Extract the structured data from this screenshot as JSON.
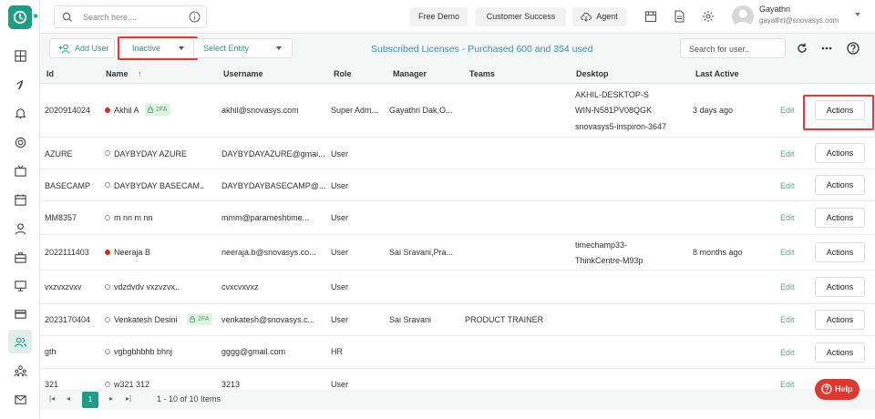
{
  "topbar": {
    "search_placeholder": "Search here....",
    "free_demo": "Free Demo",
    "customer_success": "Customer Success",
    "agent": "Agent",
    "user_name": "Gayathri",
    "user_email": "gayathri@snovasys.com"
  },
  "toolbar": {
    "add_user": "Add User",
    "status_filter": "Inactive",
    "entity_filter": "Select Entity",
    "licenses_text": "Subscribed Licenses - Purchased 600 and 354 used",
    "user_search_placeholder": "Search for user.."
  },
  "table": {
    "columns": [
      "Id",
      "Name",
      "Username",
      "Role",
      "Manager",
      "Teams",
      "Desktop",
      "Last Active"
    ],
    "sort_indicator": "↑",
    "edit_label": "Edit",
    "actions_label": "Actions",
    "badge_2fa": "2FA",
    "rows": [
      {
        "id": "2020914024",
        "name": "Akhil A",
        "username": "akhil@snovasys.com",
        "role": "Super Adm...",
        "manager": "Gayathri Dak,O...",
        "teams": "",
        "desktop1": "AKHIL-DESKTOP-S",
        "desktop2": "WIN-N581PV08QGK",
        "desktop3": "snovasys5-inspiron-3647",
        "last_active": "3 days ago",
        "status": "red",
        "twofa": true
      },
      {
        "id": "AZURE",
        "name": "DAYBYDAY AZURE",
        "username": "DAYBYDAYAZURE@gmai...",
        "role": "User",
        "manager": "",
        "teams": "",
        "desktop1": "",
        "desktop2": "",
        "desktop3": "",
        "last_active": "",
        "status": "ring",
        "twofa": false
      },
      {
        "id": "BASECAMP",
        "name": "DAYBYDAY BASECAM..",
        "username": "DAYBYDAYBASECAMP@...",
        "role": "User",
        "manager": "",
        "teams": "",
        "desktop1": "",
        "desktop2": "",
        "desktop3": "",
        "last_active": "",
        "status": "ring",
        "twofa": false
      },
      {
        "id": "MM8357",
        "name": "m nn m nn",
        "username": "mmm@parameshtime...",
        "role": "User",
        "manager": "",
        "teams": "",
        "desktop1": "",
        "desktop2": "",
        "desktop3": "",
        "last_active": "",
        "status": "ring",
        "twofa": false
      },
      {
        "id": "2022111403",
        "name": "Neeraja B",
        "username": "neeraja.b@snovasys.co...",
        "role": "User",
        "manager": "Sai Sravani,Pra...",
        "teams": "",
        "desktop1": "timechamp33-",
        "desktop2": "ThinkCentre-M93p",
        "desktop3": "",
        "last_active": "8 months ago",
        "status": "red",
        "twofa": false
      },
      {
        "id": "vxzvxzvxv",
        "name": "vdzdvdv vxzvzvx..",
        "username": "cvxcvxvxz",
        "role": "User",
        "manager": "",
        "teams": "",
        "desktop1": "",
        "desktop2": "",
        "desktop3": "",
        "last_active": "",
        "status": "ring",
        "twofa": false
      },
      {
        "id": "2023170404",
        "name": "Venkatesh Desini",
        "username": "venkatesh@snovasys.c...",
        "role": "User",
        "manager": "Sai Sravani",
        "teams": "PRODUCT TRAINER",
        "desktop1": "",
        "desktop2": "",
        "desktop3": "",
        "last_active": "",
        "status": "ring",
        "twofa": true
      },
      {
        "id": "gth",
        "name": "vgbgbhbhb bhnj",
        "username": "gggg@gmail.com",
        "role": "HR",
        "manager": "",
        "teams": "",
        "desktop1": "",
        "desktop2": "",
        "desktop3": "",
        "last_active": "",
        "status": "ring",
        "twofa": false
      },
      {
        "id": "321",
        "name": "w321 312",
        "username": "3213",
        "role": "User",
        "manager": "",
        "teams": "",
        "desktop1": "",
        "desktop2": "",
        "desktop3": "",
        "last_active": "",
        "status": "ring",
        "twofa": false
      }
    ]
  },
  "pager": {
    "current_page": "1",
    "info": "1 - 10 of 10 Items"
  },
  "help": {
    "label": "Help"
  },
  "colors": {
    "brand": "#1e9d86",
    "highlight": "#e53935",
    "licenses": "#3d8fb3"
  }
}
